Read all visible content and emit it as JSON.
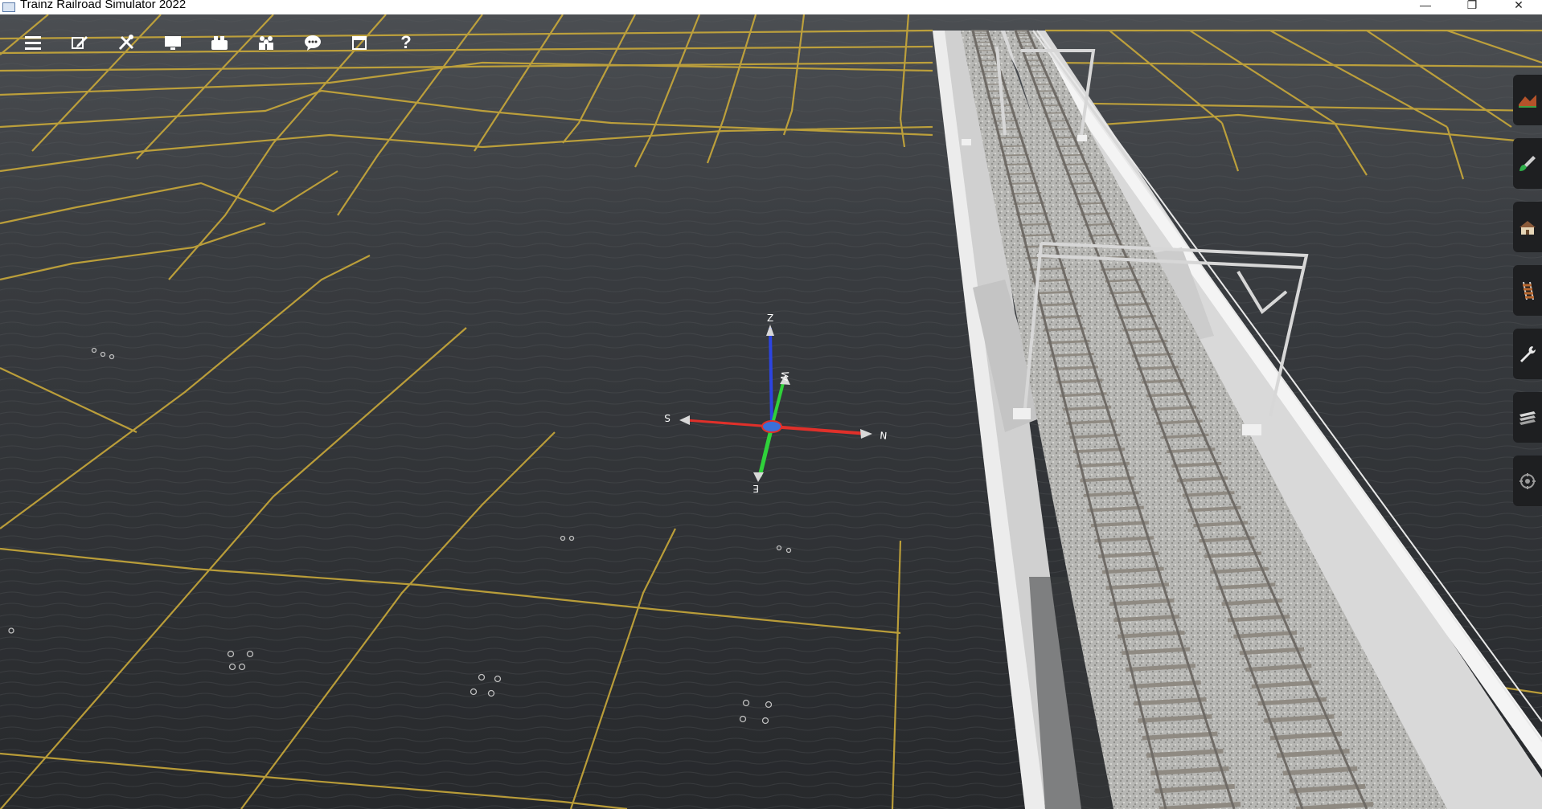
{
  "window": {
    "title": "Trainz Railroad Simulator 2022",
    "minimize_glyph": "—",
    "restore_glyph": "❐",
    "close_glyph": "✕"
  },
  "toolbar": {
    "items": [
      {
        "name": "menu",
        "icon": "hamburger-icon"
      },
      {
        "name": "edit",
        "icon": "pencil-icon"
      },
      {
        "name": "tools",
        "icon": "tools-icon"
      },
      {
        "name": "display",
        "icon": "monitor-icon"
      },
      {
        "name": "camera",
        "icon": "camera-icon"
      },
      {
        "name": "drivers",
        "icon": "people-icon"
      },
      {
        "name": "chat",
        "icon": "chat-icon"
      },
      {
        "name": "windows",
        "icon": "window-icon"
      },
      {
        "name": "help",
        "icon": "help-icon",
        "label": "?"
      }
    ]
  },
  "palette": {
    "tabs": [
      {
        "name": "terrain",
        "icon": "terrain-icon"
      },
      {
        "name": "paint",
        "icon": "paint-brush-icon"
      },
      {
        "name": "objects",
        "icon": "house-icon"
      },
      {
        "name": "track",
        "icon": "track-icon"
      },
      {
        "name": "tools",
        "icon": "wrench-icon"
      },
      {
        "name": "layers",
        "icon": "layers-icon"
      },
      {
        "name": "settings",
        "icon": "gear-icon"
      }
    ]
  },
  "gizmo": {
    "up_label": "Z",
    "north_label": "N",
    "south_label": "S",
    "east_label": "E",
    "west_label": "W"
  },
  "colors": {
    "grid_line": "#c9a93a",
    "water": "#2b2e31",
    "axis_x": "#e0302a",
    "axis_y": "#2fd13a",
    "axis_z": "#2c44e0"
  }
}
